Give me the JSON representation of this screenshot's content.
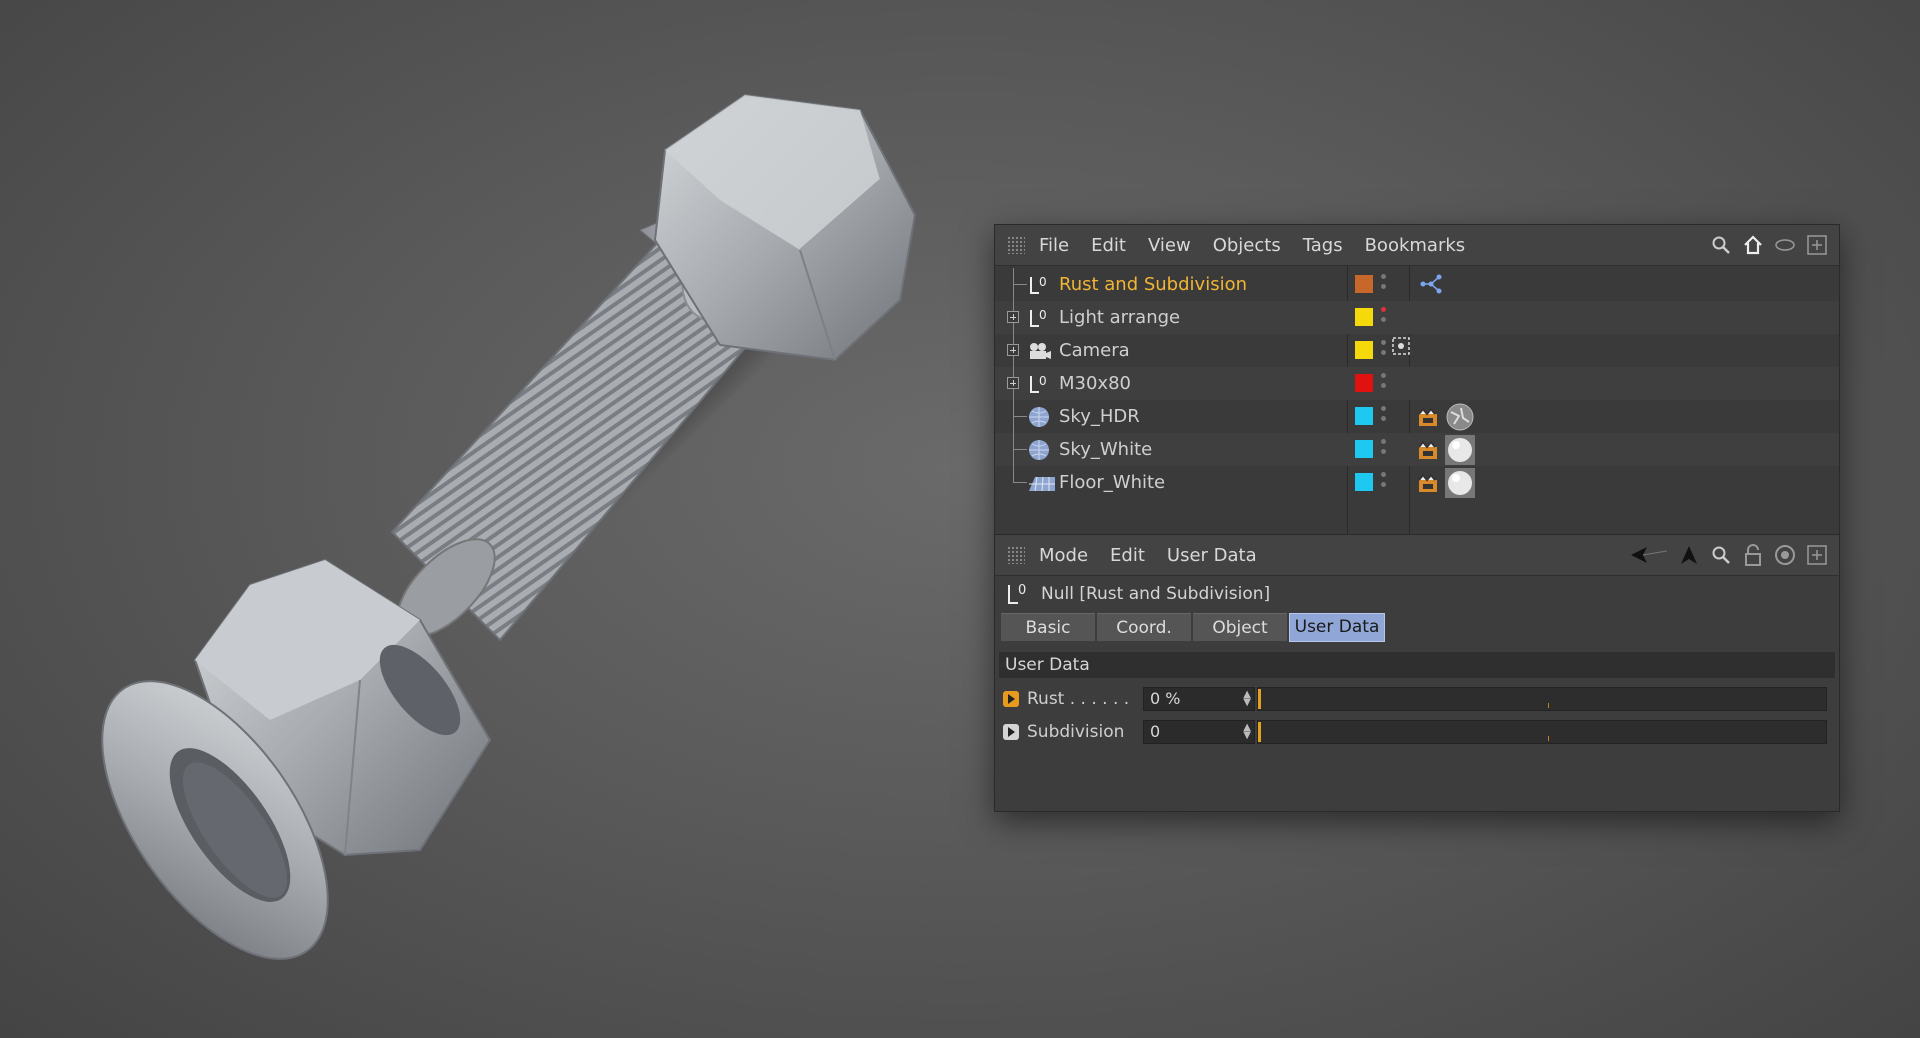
{
  "object_manager": {
    "menu": [
      "File",
      "Edit",
      "View",
      "Objects",
      "Tags",
      "Bookmarks"
    ],
    "objects": [
      {
        "name": "Rust and Subdivision",
        "icon": "null-icon",
        "color": "#c8672a",
        "selected": true,
        "expandable": false,
        "tags": [
          "xpresso-tag-icon"
        ]
      },
      {
        "name": "Light arrange",
        "icon": "null-icon",
        "color": "#f5d90a",
        "selected": false,
        "expandable": true,
        "tags": []
      },
      {
        "name": "Camera",
        "icon": "camera-icon",
        "color": "#f5d90a",
        "selected": false,
        "expandable": true,
        "tags": [
          "camera-target-tag-icon"
        ]
      },
      {
        "name": "M30x80",
        "icon": "null-icon",
        "color": "#e0120f",
        "selected": false,
        "expandable": true,
        "tags": []
      },
      {
        "name": "Sky_HDR",
        "icon": "sky-icon",
        "color": "#1ec8f0",
        "selected": false,
        "expandable": false,
        "tags": [
          "compositing-tag-icon",
          "texture-tag-icon"
        ]
      },
      {
        "name": "Sky_White",
        "icon": "sky-icon",
        "color": "#1ec8f0",
        "selected": false,
        "expandable": false,
        "tags": [
          "compositing-tag-icon",
          "material-sphere-icon"
        ]
      },
      {
        "name": "Floor_White",
        "icon": "floor-icon",
        "color": "#1ec8f0",
        "selected": false,
        "expandable": false,
        "tags": [
          "compositing-tag-icon",
          "material-sphere-icon"
        ]
      }
    ]
  },
  "attribute_manager": {
    "menu": [
      "Mode",
      "Edit",
      "User Data"
    ],
    "title": "Null [Rust and Subdivision]",
    "tabs": [
      {
        "label": "Basic",
        "active": false
      },
      {
        "label": "Coord.",
        "active": false
      },
      {
        "label": "Object",
        "active": false
      },
      {
        "label": "User Data",
        "active": true
      }
    ],
    "section": "User Data",
    "params": [
      {
        "label": "Rust . . . . . .",
        "value": "0 %",
        "fraction": 0
      },
      {
        "label": "Subdivision",
        "value": "0",
        "fraction": 0
      }
    ]
  },
  "colors": {
    "accent_selected": "#f2b534",
    "tab_active": "#8fa6d6",
    "slider_knob": "#e6a020"
  }
}
